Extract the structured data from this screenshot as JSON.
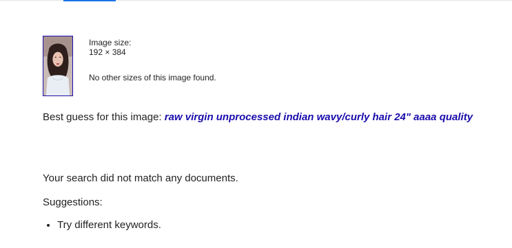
{
  "image_info": {
    "size_label": "Image size:",
    "size_value": "192 × 384",
    "no_other_sizes": "No other sizes of this image found."
  },
  "best_guess": {
    "prefix": "Best guess for this image: ",
    "query": "raw virgin unprocessed indian wavy/curly hair 24\" aaaa quality"
  },
  "results": {
    "no_match": "Your search did not match any documents.",
    "suggestions_title": "Suggestions:",
    "suggestions": [
      "Try different keywords."
    ]
  },
  "colors": {
    "link": "#1a0dab",
    "accent": "#1a73e8",
    "text": "#222222"
  },
  "icons": {
    "thumbnail": "image-thumbnail"
  }
}
